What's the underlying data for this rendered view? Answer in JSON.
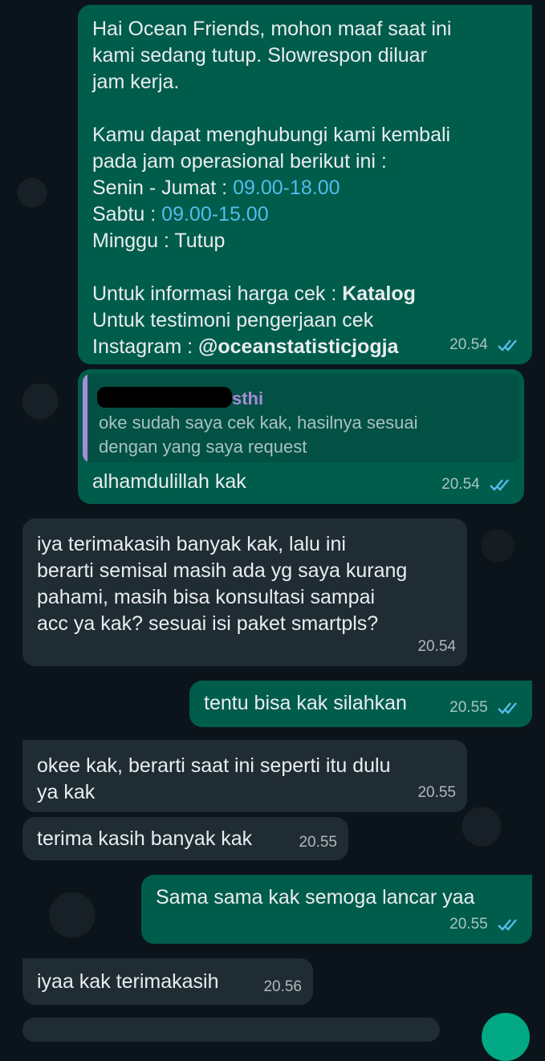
{
  "messages": [
    {
      "dir": "out",
      "time": "20.54",
      "status": "read",
      "lines": {
        "l1": "Hai Ocean Friends, mohon maaf saat ini",
        "l2": "kami sedang tutup. Slowrespon diluar",
        "l3": "jam kerja.",
        "l4": "Kamu dapat menghubungi kami kembali",
        "l5": "pada jam operasional berikut ini :",
        "l6_label": "Senin - Jumat : ",
        "l6_value": "09.00-18.00",
        "l7_label": "Sabtu : ",
        "l7_value": "09.00-15.00",
        "l8": "Minggu : Tutup",
        "l9_label": "Untuk informasi harga cek : ",
        "l9_bold": "Katalog",
        "l10": "Untuk testimoni pengerjaan cek",
        "l11_label": "Instagram : ",
        "l11_bold": "@oceanstatisticjogja"
      }
    },
    {
      "dir": "out",
      "time": "20.54",
      "status": "read",
      "quote": {
        "name_visible": "sthi",
        "text_1": "oke  sudah saya cek kak, hasilnya sesuai",
        "text_2": "dengan yang saya request"
      },
      "text": "alhamdulillah kak"
    },
    {
      "dir": "in",
      "time": "20.54",
      "text_1": "iya terimakasih banyak kak, lalu ini",
      "text_2": "berarti semisal masih ada yg saya kurang",
      "text_3": "pahami, masih bisa konsultasi sampai",
      "text_4": "acc ya kak? sesuai isi paket smartpls?"
    },
    {
      "dir": "out",
      "time": "20.55",
      "status": "read",
      "text": "tentu bisa kak silahkan"
    },
    {
      "dir": "in",
      "time": "20.55",
      "text_1": "okee kak, berarti saat ini seperti itu dulu",
      "text_2": "ya kak"
    },
    {
      "dir": "in",
      "time": "20.55",
      "text": "terima kasih banyak kak"
    },
    {
      "dir": "out",
      "time": "20.55",
      "status": "read",
      "text": "Sama sama kak semoga lancar yaa"
    },
    {
      "dir": "in",
      "time": "20.56",
      "text": "iyaa kak terimakasih"
    }
  ],
  "colors": {
    "outgoing_bubble": "#005c4b",
    "incoming_bubble": "#202c33",
    "background": "#0b141a",
    "link": "#53bdeb",
    "read_ticks": "#53bdeb",
    "quote_name": "#a78bda"
  }
}
